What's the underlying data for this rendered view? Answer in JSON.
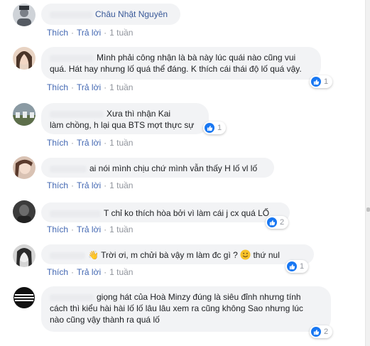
{
  "actions": {
    "like": "Thích",
    "reply": "Trả lời",
    "separator": "·"
  },
  "comments": [
    {
      "author": "Châu Nhật Nguyên",
      "text": "",
      "time": "1 tuần",
      "reactions": ""
    },
    {
      "author": "",
      "text_lines": [
        "Mình phải công nhận là bà này lúc quái nào cũng vui",
        "quá. Hát hay nhưng lố quá thể đáng. K thích cái thái độ lố quá vậy."
      ],
      "time": "1 tuần",
      "reactions": "1"
    },
    {
      "author": "",
      "text_lines": [
        "Xưa thì nhận Kai",
        "làm chồng, h lại qua BTS mợt thực sự"
      ],
      "time": "1 tuần",
      "reactions": "1"
    },
    {
      "author": "",
      "text_lines": [
        "ai nói mình chịu chứ mình vẫn thấy H lố vl lố"
      ],
      "time": "1 tuần",
      "reactions": ""
    },
    {
      "author": "",
      "text_lines": [
        "T chỉ ko thích hòa bởi vì làm cái j cx quá LỐ"
      ],
      "time": "1 tuần",
      "reactions": "2"
    },
    {
      "author": "",
      "text_before": "Trời ơi, m chửi bà vậy m làm đc gì ?",
      "text_after": "thứ nul",
      "time": "1 tuần",
      "reactions": "1"
    },
    {
      "author": "",
      "text_lines": [
        "giọng hát của Hoà Minzy đúng là siêu đỉnh nhưng tính",
        "cách thì kiểu hài hài lố lố lâu lâu xem ra cũng không Sao nhưng lúc",
        "nào cũng vậy thành ra quá lố"
      ],
      "time": "",
      "reactions": "2"
    }
  ]
}
